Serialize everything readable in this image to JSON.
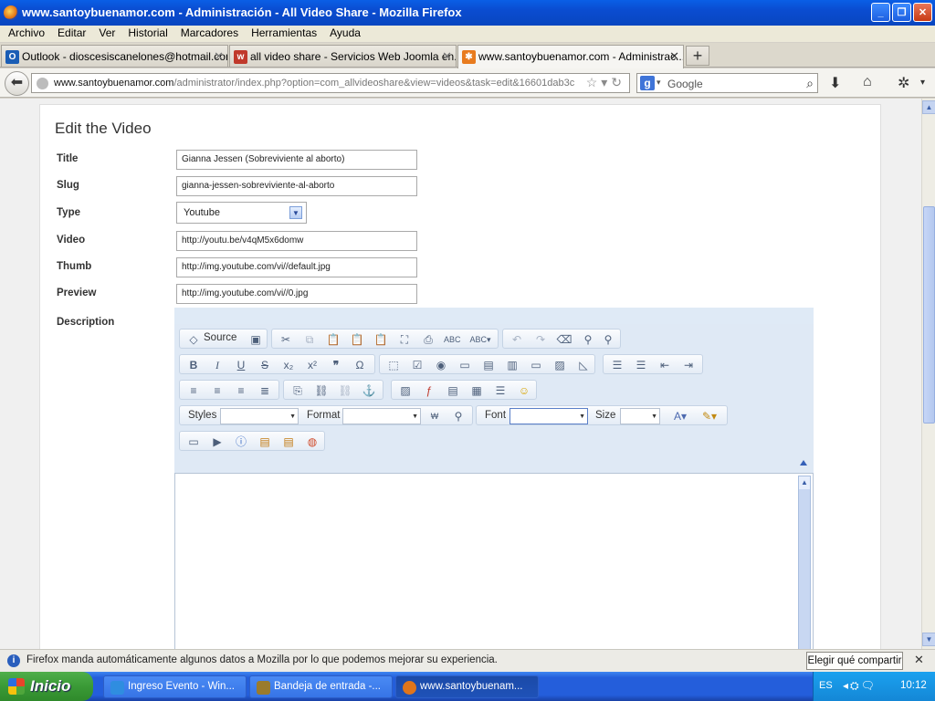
{
  "window": {
    "title": "www.santoybuenamor.com - Administración - All Video Share - Mozilla Firefox",
    "minimize": "_",
    "maximize": "❐",
    "close": "✕"
  },
  "menu": [
    "Archivo",
    "Editar",
    "Ver",
    "Historial",
    "Marcadores",
    "Herramientas",
    "Ayuda"
  ],
  "tabs": [
    {
      "label": "Outlook - dioscesiscanelones@hotmail.com",
      "icon": "outlook-icon",
      "color": "#1a5db5"
    },
    {
      "label": "all video share - Servicios Web Joomla en...",
      "icon": "joomla-w-icon",
      "color": "#c0392b"
    },
    {
      "label": "www.santoybuenamor.com - Administrac...",
      "icon": "joomla-icon",
      "color": "#e87b1e",
      "active": true
    }
  ],
  "newtab": "+",
  "nav": {
    "url_domain": "www.santoybuenamor.com",
    "url_path": "/administrator/index.php?option=com_allvideoshare&view=videos&task=edit&16601dab3c",
    "search_placeholder": "Google"
  },
  "form": {
    "heading": "Edit the Video",
    "title_label": "Title",
    "title_value": "Gianna Jessen (Sobreviviente al aborto)",
    "slug_label": "Slug",
    "slug_value": "gianna-jessen-sobreviviente-al-aborto",
    "type_label": "Type",
    "type_value": "Youtube",
    "video_label": "Video",
    "video_value": "http://youtu.be/v4qM5x6domw",
    "thumb_label": "Thumb",
    "thumb_value": "http://img.youtube.com/vi//default.jpg",
    "preview_label": "Preview",
    "preview_value": "http://img.youtube.com/vi//0.jpg",
    "description_label": "Description"
  },
  "editor": {
    "source_label": "Source",
    "styles_label": "Styles",
    "format_label": "Format",
    "font_label": "Font",
    "size_label": "Size"
  },
  "notification": {
    "message": "Firefox manda automáticamente algunos datos a Mozilla por lo que podemos mejorar su experiencia.",
    "button": "Elegir qué compartir",
    "close": "✕"
  },
  "taskbar": {
    "start": "Inicio",
    "tasks": [
      {
        "label": "Ingreso Evento - Win...",
        "color": "#2f8de0"
      },
      {
        "label": "Bandeja de entrada -...",
        "color": "#9a7b2c"
      },
      {
        "label": "www.santoybuenam...",
        "color": "#e0751b",
        "active": true
      }
    ],
    "lang": "ES",
    "clock": "10:12"
  }
}
